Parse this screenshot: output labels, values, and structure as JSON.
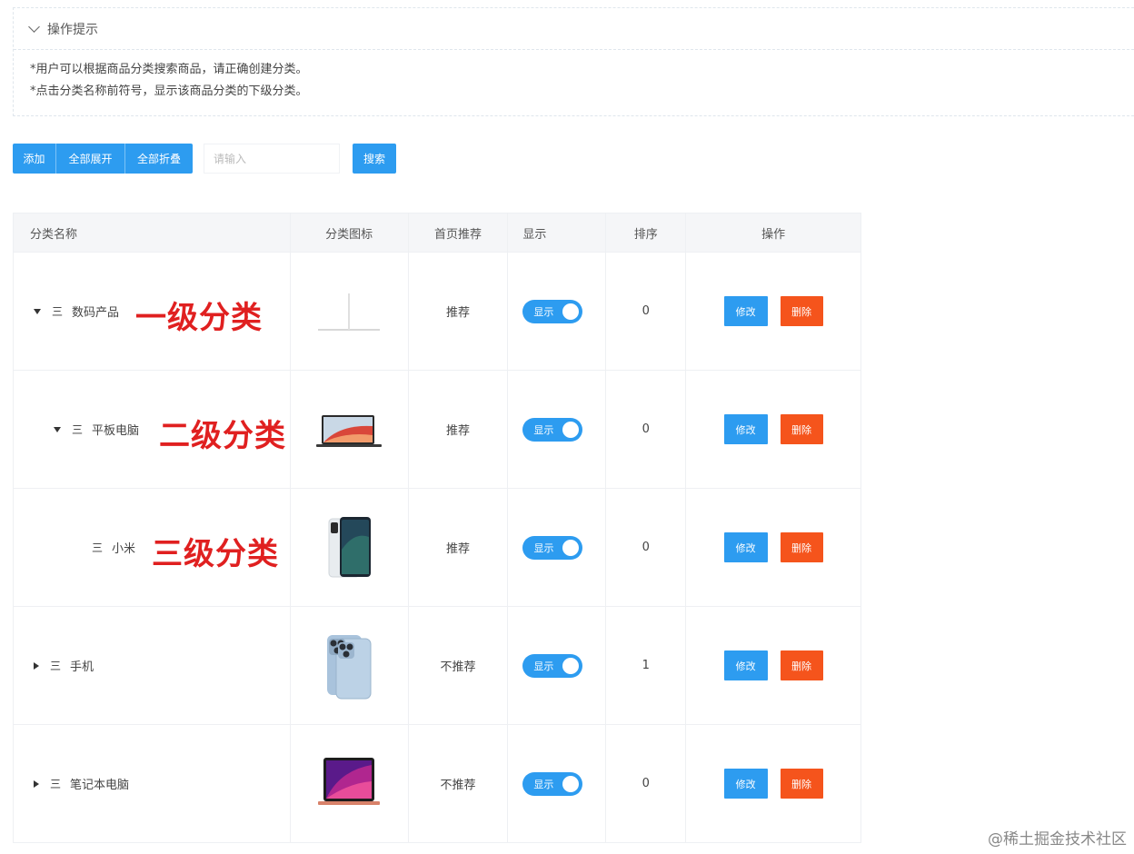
{
  "tips": {
    "title": "操作提示",
    "lines": [
      "*用户可以根据商品分类搜索商品，请正确创建分类。",
      "*点击分类名称前符号，显示该商品分类的下级分类。"
    ]
  },
  "toolbar": {
    "add": "添加",
    "expand_all": "全部展开",
    "collapse_all": "全部折叠",
    "search_placeholder": "请输入",
    "search": "搜索"
  },
  "table": {
    "headers": [
      "分类名称",
      "分类图标",
      "首页推荐",
      "显示",
      "排序",
      "操作"
    ],
    "rows": [
      {
        "name": "数码产品",
        "expanded": true,
        "icon": "monitor-image",
        "recommend": "推荐",
        "show": "显示",
        "sort": "0",
        "edit": "修改",
        "delete": "删除",
        "annotation": "一级分类"
      },
      {
        "name": "平板电脑",
        "expanded": true,
        "icon": "laptop-image",
        "recommend": "推荐",
        "show": "显示",
        "sort": "0",
        "edit": "修改",
        "delete": "删除",
        "annotation": "二级分类"
      },
      {
        "name": "小米",
        "expanded": null,
        "icon": "tablet-image",
        "recommend": "推荐",
        "show": "显示",
        "sort": "0",
        "edit": "修改",
        "delete": "删除",
        "annotation": "三级分类"
      },
      {
        "name": "手机",
        "expanded": false,
        "icon": "phone-image",
        "recommend": "不推荐",
        "show": "显示",
        "sort": "1",
        "edit": "修改",
        "delete": "删除"
      },
      {
        "name": "笔记本电脑",
        "expanded": false,
        "icon": "macbook-image",
        "recommend": "不推荐",
        "show": "显示",
        "sort": "0",
        "edit": "修改",
        "delete": "删除"
      }
    ]
  },
  "menu_glyph": "三",
  "watermark": "@稀土掘金技术社区",
  "colors": {
    "primary": "#2d9cf0",
    "danger": "#f5541c",
    "annotation": "#e02020"
  }
}
